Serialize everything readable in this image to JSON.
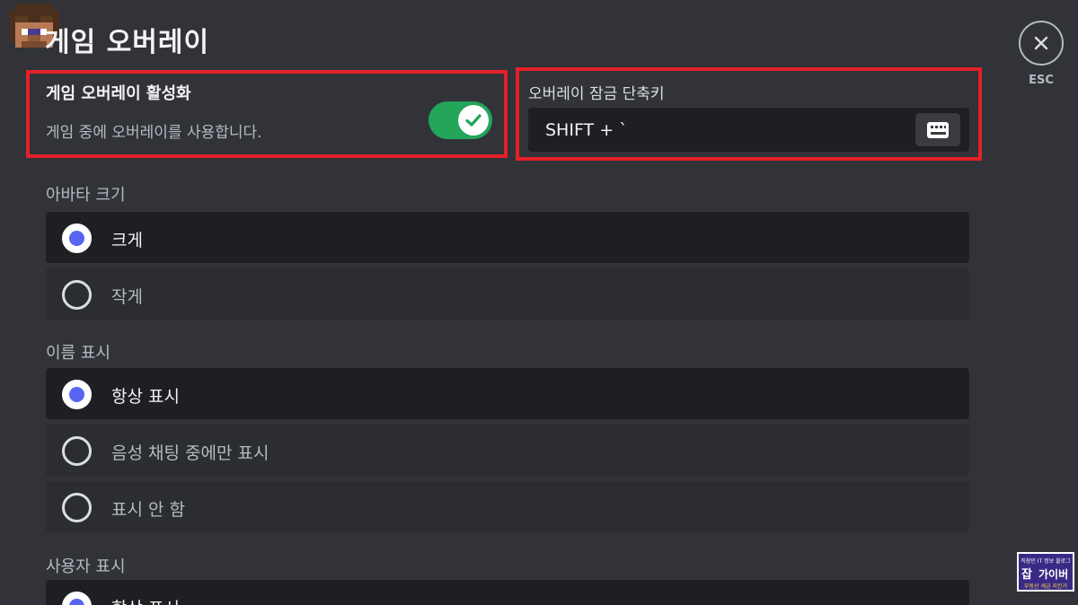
{
  "title": "게임 오버레이",
  "esc": {
    "label": "ESC",
    "icon": "close-icon"
  },
  "enable": {
    "title": "게임 오버레이 활성화",
    "description": "게임 중에 오버레이를 사용합니다.",
    "enabled": true
  },
  "shortcut": {
    "label": "오버레이 잠금 단축키",
    "value": "SHIFT + `",
    "icon": "keyboard-icon"
  },
  "avatar_size": {
    "label": "아바타 크기",
    "options": [
      {
        "label": "크게",
        "selected": true
      },
      {
        "label": "작게",
        "selected": false
      }
    ]
  },
  "name_display": {
    "label": "이름 표시",
    "options": [
      {
        "label": "항상 표시",
        "selected": true
      },
      {
        "label": "음성 채팅 중에만 표시",
        "selected": false
      },
      {
        "label": "표시 안 함",
        "selected": false
      }
    ]
  },
  "user_display": {
    "label": "사용자 표시",
    "options": [
      {
        "label": "항상 표시",
        "selected": true
      }
    ]
  },
  "watermark": {
    "top": "직장인 IT 정보 블로그",
    "main_a": "잡",
    "main_b": "가이버",
    "bottom": "부동산 세금 지킨거"
  },
  "colors": {
    "background": "#313338",
    "accent": "#5865f2",
    "toggle_on": "#23a55a",
    "highlight": "#e5202a"
  }
}
